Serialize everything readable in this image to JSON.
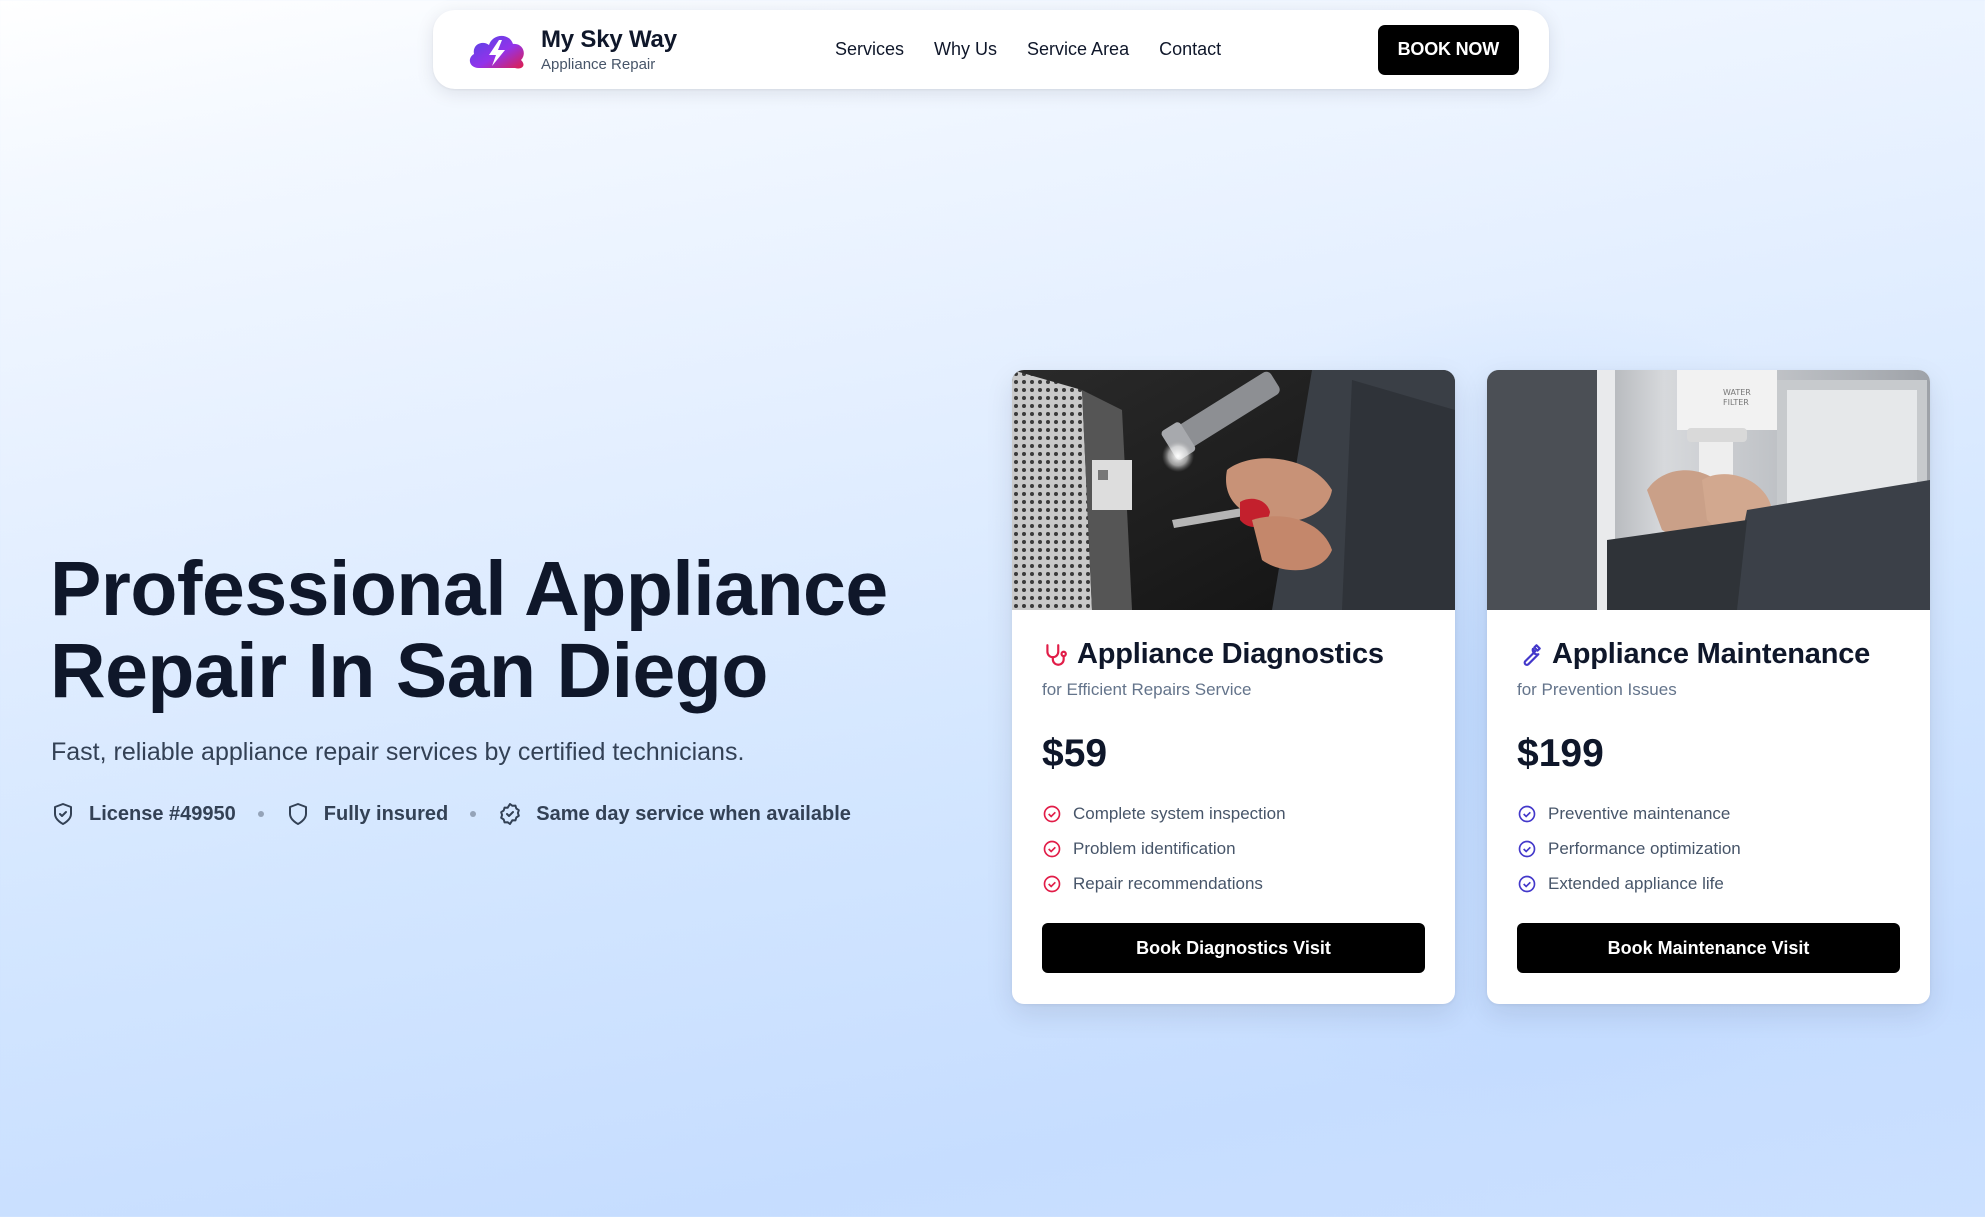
{
  "colors": {
    "text_dark": "#0f172a",
    "button_bg": "#000000",
    "diagnostics_accent": "#e11d48",
    "maintenance_accent": "#4338ca"
  },
  "navbar": {
    "brand_name": "My Sky Way",
    "brand_sub": "Appliance Repair",
    "logo_icon": "cloud-lightning-icon",
    "links": [
      "Services",
      "Why Us",
      "Service Area",
      "Contact"
    ],
    "cta_label": "BOOK NOW"
  },
  "hero": {
    "title_line1": "Professional Appliance",
    "title_line2": "Repair In San Diego",
    "subtitle": "Fast, reliable appliance repair services by certified technicians.",
    "trust": [
      {
        "icon": "shield-check-icon",
        "label": "License #49950"
      },
      {
        "icon": "shield-icon",
        "label": "Fully insured"
      },
      {
        "icon": "badge-check-icon",
        "label": "Same day service when available"
      }
    ]
  },
  "cards": [
    {
      "icon": "stethoscope-icon",
      "title": "Appliance Diagnostics",
      "subtitle": "for Efficient Repairs Service",
      "price": "$59",
      "features": [
        "Complete system inspection",
        "Problem identification",
        "Repair recommendations"
      ],
      "button_label": "Book Diagnostics Visit",
      "image": "technician-with-flashlight-photo"
    },
    {
      "icon": "wrench-icon",
      "title": "Appliance Maintenance",
      "subtitle": "for Prevention Issues",
      "price": "$199",
      "features": [
        "Preventive maintenance",
        "Performance optimization",
        "Extended appliance life"
      ],
      "button_label": "Book Maintenance Visit",
      "image": "fridge-water-filter-photo",
      "image_text": [
        "WATER",
        "FILTER"
      ]
    }
  ]
}
